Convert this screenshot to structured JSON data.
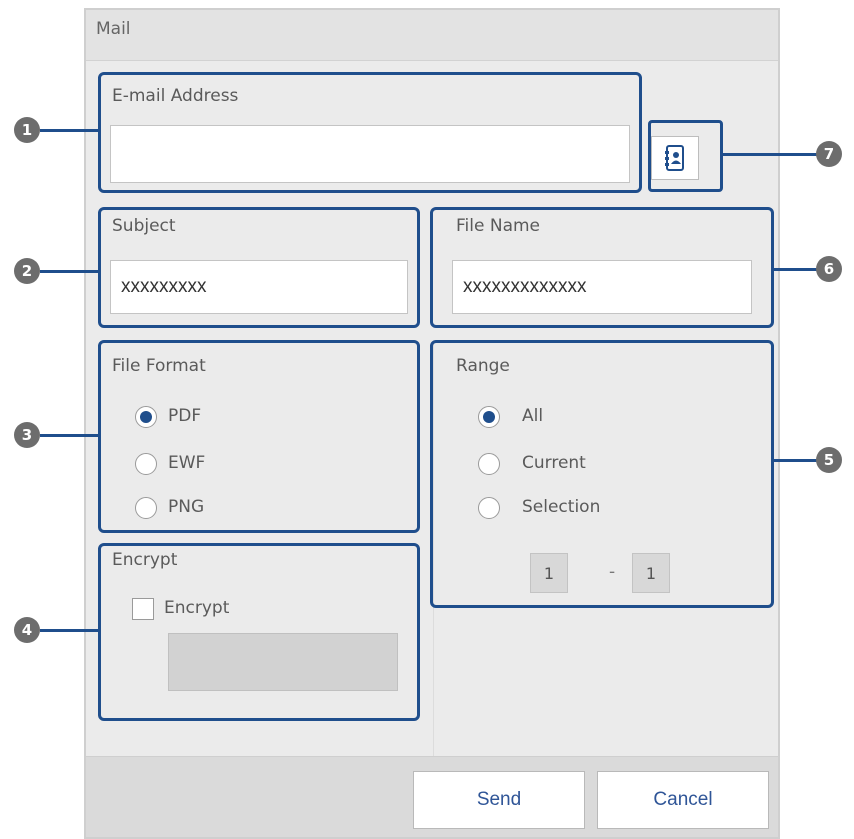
{
  "dialog": {
    "title": "Mail"
  },
  "email": {
    "label": "E-mail Address",
    "value": ""
  },
  "subject": {
    "label": "Subject",
    "value": "xxxxxxxxx"
  },
  "file_name": {
    "label": "File Name",
    "value": "xxxxxxxxxxxxx"
  },
  "file_format": {
    "label": "File Format",
    "options": [
      {
        "label": "PDF",
        "selected": true
      },
      {
        "label": "EWF",
        "selected": false
      },
      {
        "label": "PNG",
        "selected": false
      }
    ]
  },
  "range": {
    "label": "Range",
    "options": [
      {
        "label": "All",
        "selected": true
      },
      {
        "label": "Current",
        "selected": false
      },
      {
        "label": "Selection",
        "selected": false
      }
    ],
    "from": "1",
    "separator": "-",
    "to": "1"
  },
  "encrypt": {
    "section_label": "Encrypt",
    "checkbox_label": "Encrypt",
    "checked": false
  },
  "buttons": {
    "send": "Send",
    "cancel": "Cancel"
  },
  "callouts": [
    "1",
    "2",
    "3",
    "4",
    "5",
    "6",
    "7"
  ],
  "colors": {
    "callout_blue": "#1f4e8c",
    "marker_gray": "#6d6d6d",
    "button_text": "#2f5597"
  },
  "icons": {
    "contacts": "address-book-icon"
  }
}
